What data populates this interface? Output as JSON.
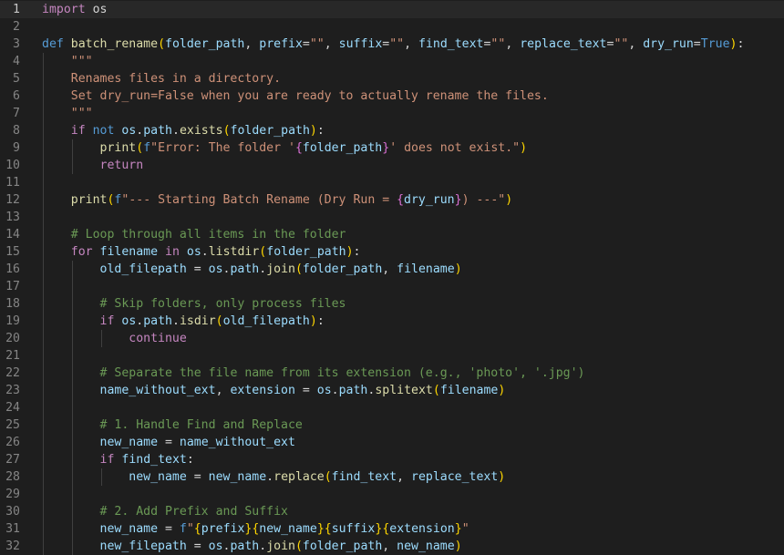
{
  "editor": {
    "language": "python",
    "current_line": 1,
    "colors": {
      "background": "#1e1e1e",
      "line_highlight": "#282828",
      "gutter": "#858585",
      "keyword": "#569cd6",
      "control": "#c586c0",
      "function": "#dcdcaa",
      "variable": "#9cdcfe",
      "string": "#ce9178",
      "comment": "#6a9955",
      "bracket_gold": "#ffd700",
      "bracket_purple": "#da70d6",
      "bracket_blue": "#179fff"
    },
    "lines": [
      {
        "number": "1",
        "tokens": [
          {
            "t": "import",
            "k": "ctl"
          },
          {
            "t": " os",
            "k": "txt"
          }
        ]
      },
      {
        "number": "2",
        "tokens": []
      },
      {
        "number": "3",
        "tokens": [
          {
            "t": "def",
            "k": "kw"
          },
          {
            "t": " ",
            "k": "txt"
          },
          {
            "t": "batch_rename",
            "k": "fn"
          },
          {
            "t": "(",
            "k": "bk1"
          },
          {
            "t": "folder_path",
            "k": "var"
          },
          {
            "t": ", ",
            "k": "txt"
          },
          {
            "t": "prefix",
            "k": "var"
          },
          {
            "t": "=",
            "k": "txt"
          },
          {
            "t": "\"\"",
            "k": "str"
          },
          {
            "t": ", ",
            "k": "txt"
          },
          {
            "t": "suffix",
            "k": "var"
          },
          {
            "t": "=",
            "k": "txt"
          },
          {
            "t": "\"\"",
            "k": "str"
          },
          {
            "t": ", ",
            "k": "txt"
          },
          {
            "t": "find_text",
            "k": "var"
          },
          {
            "t": "=",
            "k": "txt"
          },
          {
            "t": "\"\"",
            "k": "str"
          },
          {
            "t": ", ",
            "k": "txt"
          },
          {
            "t": "replace_text",
            "k": "var"
          },
          {
            "t": "=",
            "k": "txt"
          },
          {
            "t": "\"\"",
            "k": "str"
          },
          {
            "t": ", ",
            "k": "txt"
          },
          {
            "t": "dry_run",
            "k": "var"
          },
          {
            "t": "=",
            "k": "txt"
          },
          {
            "t": "True",
            "k": "kw"
          },
          {
            "t": ")",
            "k": "bk1"
          },
          {
            "t": ":",
            "k": "txt"
          }
        ]
      },
      {
        "number": "4",
        "tokens": [
          {
            "t": "    ",
            "k": "txt"
          },
          {
            "t": "\"\"\"",
            "k": "str"
          }
        ]
      },
      {
        "number": "5",
        "tokens": [
          {
            "t": "    ",
            "k": "txt"
          },
          {
            "t": "Renames files in a directory.",
            "k": "str"
          }
        ]
      },
      {
        "number": "6",
        "tokens": [
          {
            "t": "    ",
            "k": "txt"
          },
          {
            "t": "Set dry_run=False when you are ready to actually rename the files.",
            "k": "str"
          }
        ]
      },
      {
        "number": "7",
        "tokens": [
          {
            "t": "    ",
            "k": "txt"
          },
          {
            "t": "\"\"\"",
            "k": "str"
          }
        ]
      },
      {
        "number": "8",
        "tokens": [
          {
            "t": "    ",
            "k": "txt"
          },
          {
            "t": "if",
            "k": "ctl"
          },
          {
            "t": " ",
            "k": "txt"
          },
          {
            "t": "not",
            "k": "kw"
          },
          {
            "t": " ",
            "k": "txt"
          },
          {
            "t": "os",
            "k": "var"
          },
          {
            "t": ".",
            "k": "txt"
          },
          {
            "t": "path",
            "k": "var"
          },
          {
            "t": ".",
            "k": "txt"
          },
          {
            "t": "exists",
            "k": "fn"
          },
          {
            "t": "(",
            "k": "bk1"
          },
          {
            "t": "folder_path",
            "k": "var"
          },
          {
            "t": ")",
            "k": "bk1"
          },
          {
            "t": ":",
            "k": "txt"
          }
        ]
      },
      {
        "number": "9",
        "tokens": [
          {
            "t": "        ",
            "k": "txt"
          },
          {
            "t": "print",
            "k": "fn"
          },
          {
            "t": "(",
            "k": "bk1"
          },
          {
            "t": "f",
            "k": "kw"
          },
          {
            "t": "\"Error: The folder '",
            "k": "str"
          },
          {
            "t": "{",
            "k": "bk2"
          },
          {
            "t": "folder_path",
            "k": "var"
          },
          {
            "t": "}",
            "k": "bk2"
          },
          {
            "t": "' does not exist.\"",
            "k": "str"
          },
          {
            "t": ")",
            "k": "bk1"
          }
        ]
      },
      {
        "number": "10",
        "tokens": [
          {
            "t": "        ",
            "k": "txt"
          },
          {
            "t": "return",
            "k": "ctl"
          }
        ]
      },
      {
        "number": "11",
        "tokens": []
      },
      {
        "number": "12",
        "tokens": [
          {
            "t": "    ",
            "k": "txt"
          },
          {
            "t": "print",
            "k": "fn"
          },
          {
            "t": "(",
            "k": "bk1"
          },
          {
            "t": "f",
            "k": "kw"
          },
          {
            "t": "\"--- Starting Batch Rename (Dry Run = ",
            "k": "str"
          },
          {
            "t": "{",
            "k": "bk2"
          },
          {
            "t": "dry_run",
            "k": "var"
          },
          {
            "t": "}",
            "k": "bk2"
          },
          {
            "t": ") ---\"",
            "k": "str"
          },
          {
            "t": ")",
            "k": "bk1"
          }
        ]
      },
      {
        "number": "13",
        "tokens": []
      },
      {
        "number": "14",
        "tokens": [
          {
            "t": "    ",
            "k": "txt"
          },
          {
            "t": "# Loop through all items in the folder",
            "k": "cm"
          }
        ]
      },
      {
        "number": "15",
        "tokens": [
          {
            "t": "    ",
            "k": "txt"
          },
          {
            "t": "for",
            "k": "ctl"
          },
          {
            "t": " ",
            "k": "txt"
          },
          {
            "t": "filename",
            "k": "var"
          },
          {
            "t": " ",
            "k": "txt"
          },
          {
            "t": "in",
            "k": "ctl"
          },
          {
            "t": " ",
            "k": "txt"
          },
          {
            "t": "os",
            "k": "var"
          },
          {
            "t": ".",
            "k": "txt"
          },
          {
            "t": "listdir",
            "k": "fn"
          },
          {
            "t": "(",
            "k": "bk1"
          },
          {
            "t": "folder_path",
            "k": "var"
          },
          {
            "t": ")",
            "k": "bk1"
          },
          {
            "t": ":",
            "k": "txt"
          }
        ]
      },
      {
        "number": "16",
        "tokens": [
          {
            "t": "        ",
            "k": "txt"
          },
          {
            "t": "old_filepath",
            "k": "var"
          },
          {
            "t": " = ",
            "k": "txt"
          },
          {
            "t": "os",
            "k": "var"
          },
          {
            "t": ".",
            "k": "txt"
          },
          {
            "t": "path",
            "k": "var"
          },
          {
            "t": ".",
            "k": "txt"
          },
          {
            "t": "join",
            "k": "fn"
          },
          {
            "t": "(",
            "k": "bk1"
          },
          {
            "t": "folder_path",
            "k": "var"
          },
          {
            "t": ", ",
            "k": "txt"
          },
          {
            "t": "filename",
            "k": "var"
          },
          {
            "t": ")",
            "k": "bk1"
          }
        ]
      },
      {
        "number": "17",
        "tokens": []
      },
      {
        "number": "18",
        "tokens": [
          {
            "t": "        ",
            "k": "txt"
          },
          {
            "t": "# Skip folders, only process files",
            "k": "cm"
          }
        ]
      },
      {
        "number": "19",
        "tokens": [
          {
            "t": "        ",
            "k": "txt"
          },
          {
            "t": "if",
            "k": "ctl"
          },
          {
            "t": " ",
            "k": "txt"
          },
          {
            "t": "os",
            "k": "var"
          },
          {
            "t": ".",
            "k": "txt"
          },
          {
            "t": "path",
            "k": "var"
          },
          {
            "t": ".",
            "k": "txt"
          },
          {
            "t": "isdir",
            "k": "fn"
          },
          {
            "t": "(",
            "k": "bk1"
          },
          {
            "t": "old_filepath",
            "k": "var"
          },
          {
            "t": ")",
            "k": "bk1"
          },
          {
            "t": ":",
            "k": "txt"
          }
        ]
      },
      {
        "number": "20",
        "tokens": [
          {
            "t": "            ",
            "k": "txt"
          },
          {
            "t": "continue",
            "k": "ctl"
          }
        ]
      },
      {
        "number": "21",
        "tokens": []
      },
      {
        "number": "22",
        "tokens": [
          {
            "t": "        ",
            "k": "txt"
          },
          {
            "t": "# Separate the file name from its extension (e.g., 'photo', '.jpg')",
            "k": "cm"
          }
        ]
      },
      {
        "number": "23",
        "tokens": [
          {
            "t": "        ",
            "k": "txt"
          },
          {
            "t": "name_without_ext",
            "k": "var"
          },
          {
            "t": ", ",
            "k": "txt"
          },
          {
            "t": "extension",
            "k": "var"
          },
          {
            "t": " = ",
            "k": "txt"
          },
          {
            "t": "os",
            "k": "var"
          },
          {
            "t": ".",
            "k": "txt"
          },
          {
            "t": "path",
            "k": "var"
          },
          {
            "t": ".",
            "k": "txt"
          },
          {
            "t": "splitext",
            "k": "fn"
          },
          {
            "t": "(",
            "k": "bk1"
          },
          {
            "t": "filename",
            "k": "var"
          },
          {
            "t": ")",
            "k": "bk1"
          }
        ]
      },
      {
        "number": "24",
        "tokens": []
      },
      {
        "number": "25",
        "tokens": [
          {
            "t": "        ",
            "k": "txt"
          },
          {
            "t": "# 1. Handle Find and Replace",
            "k": "cm"
          }
        ]
      },
      {
        "number": "26",
        "tokens": [
          {
            "t": "        ",
            "k": "txt"
          },
          {
            "t": "new_name",
            "k": "var"
          },
          {
            "t": " = ",
            "k": "txt"
          },
          {
            "t": "name_without_ext",
            "k": "var"
          }
        ]
      },
      {
        "number": "27",
        "tokens": [
          {
            "t": "        ",
            "k": "txt"
          },
          {
            "t": "if",
            "k": "ctl"
          },
          {
            "t": " ",
            "k": "txt"
          },
          {
            "t": "find_text",
            "k": "var"
          },
          {
            "t": ":",
            "k": "txt"
          }
        ]
      },
      {
        "number": "28",
        "tokens": [
          {
            "t": "            ",
            "k": "txt"
          },
          {
            "t": "new_name",
            "k": "var"
          },
          {
            "t": " = ",
            "k": "txt"
          },
          {
            "t": "new_name",
            "k": "var"
          },
          {
            "t": ".",
            "k": "txt"
          },
          {
            "t": "replace",
            "k": "fn"
          },
          {
            "t": "(",
            "k": "bk1"
          },
          {
            "t": "find_text",
            "k": "var"
          },
          {
            "t": ", ",
            "k": "txt"
          },
          {
            "t": "replace_text",
            "k": "var"
          },
          {
            "t": ")",
            "k": "bk1"
          }
        ]
      },
      {
        "number": "29",
        "tokens": []
      },
      {
        "number": "30",
        "tokens": [
          {
            "t": "        ",
            "k": "txt"
          },
          {
            "t": "# 2. Add Prefix and Suffix",
            "k": "cm"
          }
        ]
      },
      {
        "number": "31",
        "tokens": [
          {
            "t": "        ",
            "k": "txt"
          },
          {
            "t": "new_name",
            "k": "var"
          },
          {
            "t": " = ",
            "k": "txt"
          },
          {
            "t": "f",
            "k": "kw"
          },
          {
            "t": "\"",
            "k": "str"
          },
          {
            "t": "{",
            "k": "bk1"
          },
          {
            "t": "prefix",
            "k": "var"
          },
          {
            "t": "}",
            "k": "bk1"
          },
          {
            "t": "{",
            "k": "bk1"
          },
          {
            "t": "new_name",
            "k": "var"
          },
          {
            "t": "}",
            "k": "bk1"
          },
          {
            "t": "{",
            "k": "bk1"
          },
          {
            "t": "suffix",
            "k": "var"
          },
          {
            "t": "}",
            "k": "bk1"
          },
          {
            "t": "{",
            "k": "bk1"
          },
          {
            "t": "extension",
            "k": "var"
          },
          {
            "t": "}",
            "k": "bk1"
          },
          {
            "t": "\"",
            "k": "str"
          }
        ]
      },
      {
        "number": "32",
        "tokens": [
          {
            "t": "        ",
            "k": "txt"
          },
          {
            "t": "new_filepath",
            "k": "var"
          },
          {
            "t": " = ",
            "k": "txt"
          },
          {
            "t": "os",
            "k": "var"
          },
          {
            "t": ".",
            "k": "txt"
          },
          {
            "t": "path",
            "k": "var"
          },
          {
            "t": ".",
            "k": "txt"
          },
          {
            "t": "join",
            "k": "fn"
          },
          {
            "t": "(",
            "k": "bk1"
          },
          {
            "t": "folder_path",
            "k": "var"
          },
          {
            "t": ", ",
            "k": "txt"
          },
          {
            "t": "new_name",
            "k": "var"
          },
          {
            "t": ")",
            "k": "bk1"
          }
        ]
      }
    ]
  }
}
